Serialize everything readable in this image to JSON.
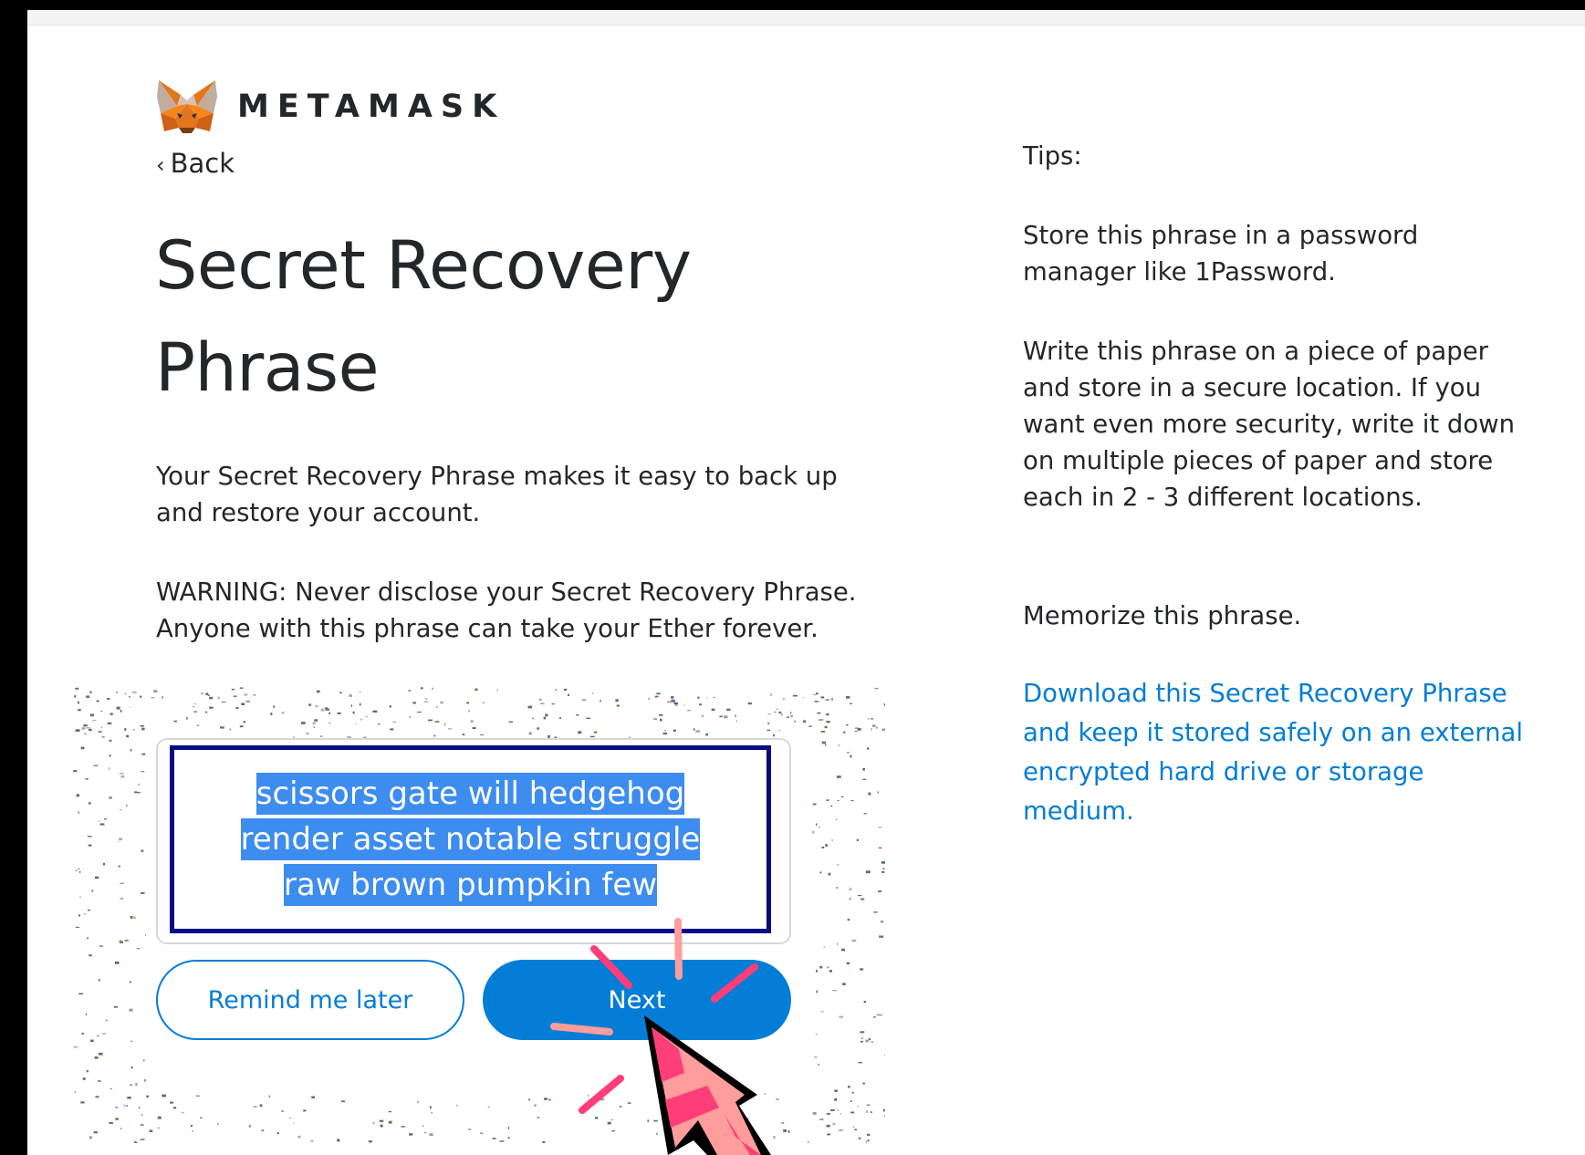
{
  "header": {
    "brand": "METAMASK",
    "back_label": "Back"
  },
  "main": {
    "title": "Secret Recovery Phrase",
    "intro": "Your Secret Recovery Phrase makes it easy to back up and restore your account.",
    "warning": "WARNING: Never disclose your Secret Recovery Phrase. Anyone with this phrase can take your Ether forever.",
    "phrase": "scissors gate will hedgehog render asset notable struggle raw brown pumpkin few",
    "remind_label": "Remind me later",
    "next_label": "Next"
  },
  "tips": {
    "heading": "Tips:",
    "items": [
      "Store this phrase in a password manager like 1Password.",
      "Write this phrase on a piece of paper and store in a secure location. If you want even more security, write it down on multiple pieces of paper and store each in 2 - 3 different locations.",
      "Memorize this phrase."
    ],
    "download_link": "Download this Secret Recovery Phrase and keep it stored safely on an external encrypted hard drive or storage medium."
  },
  "colors": {
    "accent": "#037dd6",
    "text": "#24272a",
    "selection": "#3d8cf0",
    "focus_border": "#0b0a85",
    "cursor_pink": "#ff3d78"
  },
  "icons": {
    "logo": "metamask-fox-icon",
    "back": "chevron-left-icon",
    "pointer": "mouse-cursor-icon"
  }
}
